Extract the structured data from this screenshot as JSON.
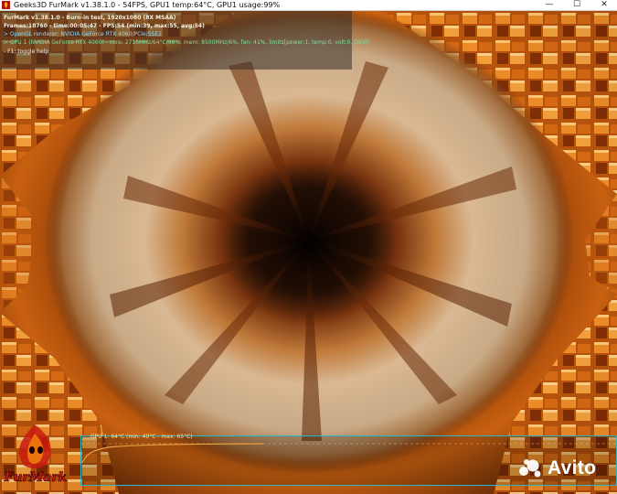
{
  "window": {
    "title": "Geeks3D FurMark v1.38.1.0 - 54FPS, GPU1 temp:64°C, GPU1 usage:99%",
    "controls": {
      "minimize": "—",
      "maximize": "☐",
      "close": "✕"
    }
  },
  "osd": {
    "line1": "FurMark v1.38.1.0 - Burn-in test, 1920x1080 (8X MSAA)",
    "line2": "Frames:18760 - time:00:05:47 - FPS:54 (min:39, max:55, avg:54)",
    "line3": "> OpenGL renderer: NVIDIA GeForce RTX 4060/PCIe/SSE2",
    "line4": "> GPU 1 (NVIDIA GeForce RTX 4060) - core: 2715MHz/64°C/99%, mem: 8500MHz/6%, fan: 41%, limits[power:1, temp:0, volt:0, OV:0]",
    "line5": "- F1: toggle help"
  },
  "graph": {
    "label": "GPU 1: 64°C (min: 40°C - max: 65°C)",
    "current_temp_c": 64,
    "min_temp_c": 40,
    "max_temp_c": 65,
    "line_color": "#e8a040",
    "border_color": "#2ab8c8"
  },
  "logo": {
    "text": "FurMark"
  },
  "watermark": {
    "text": "Avito"
  },
  "colors": {
    "accent": "#f08020",
    "osd_title": "#f6f2e0",
    "osd_gl": "#8fd9ff",
    "osd_gpu": "#7fe0a0"
  }
}
